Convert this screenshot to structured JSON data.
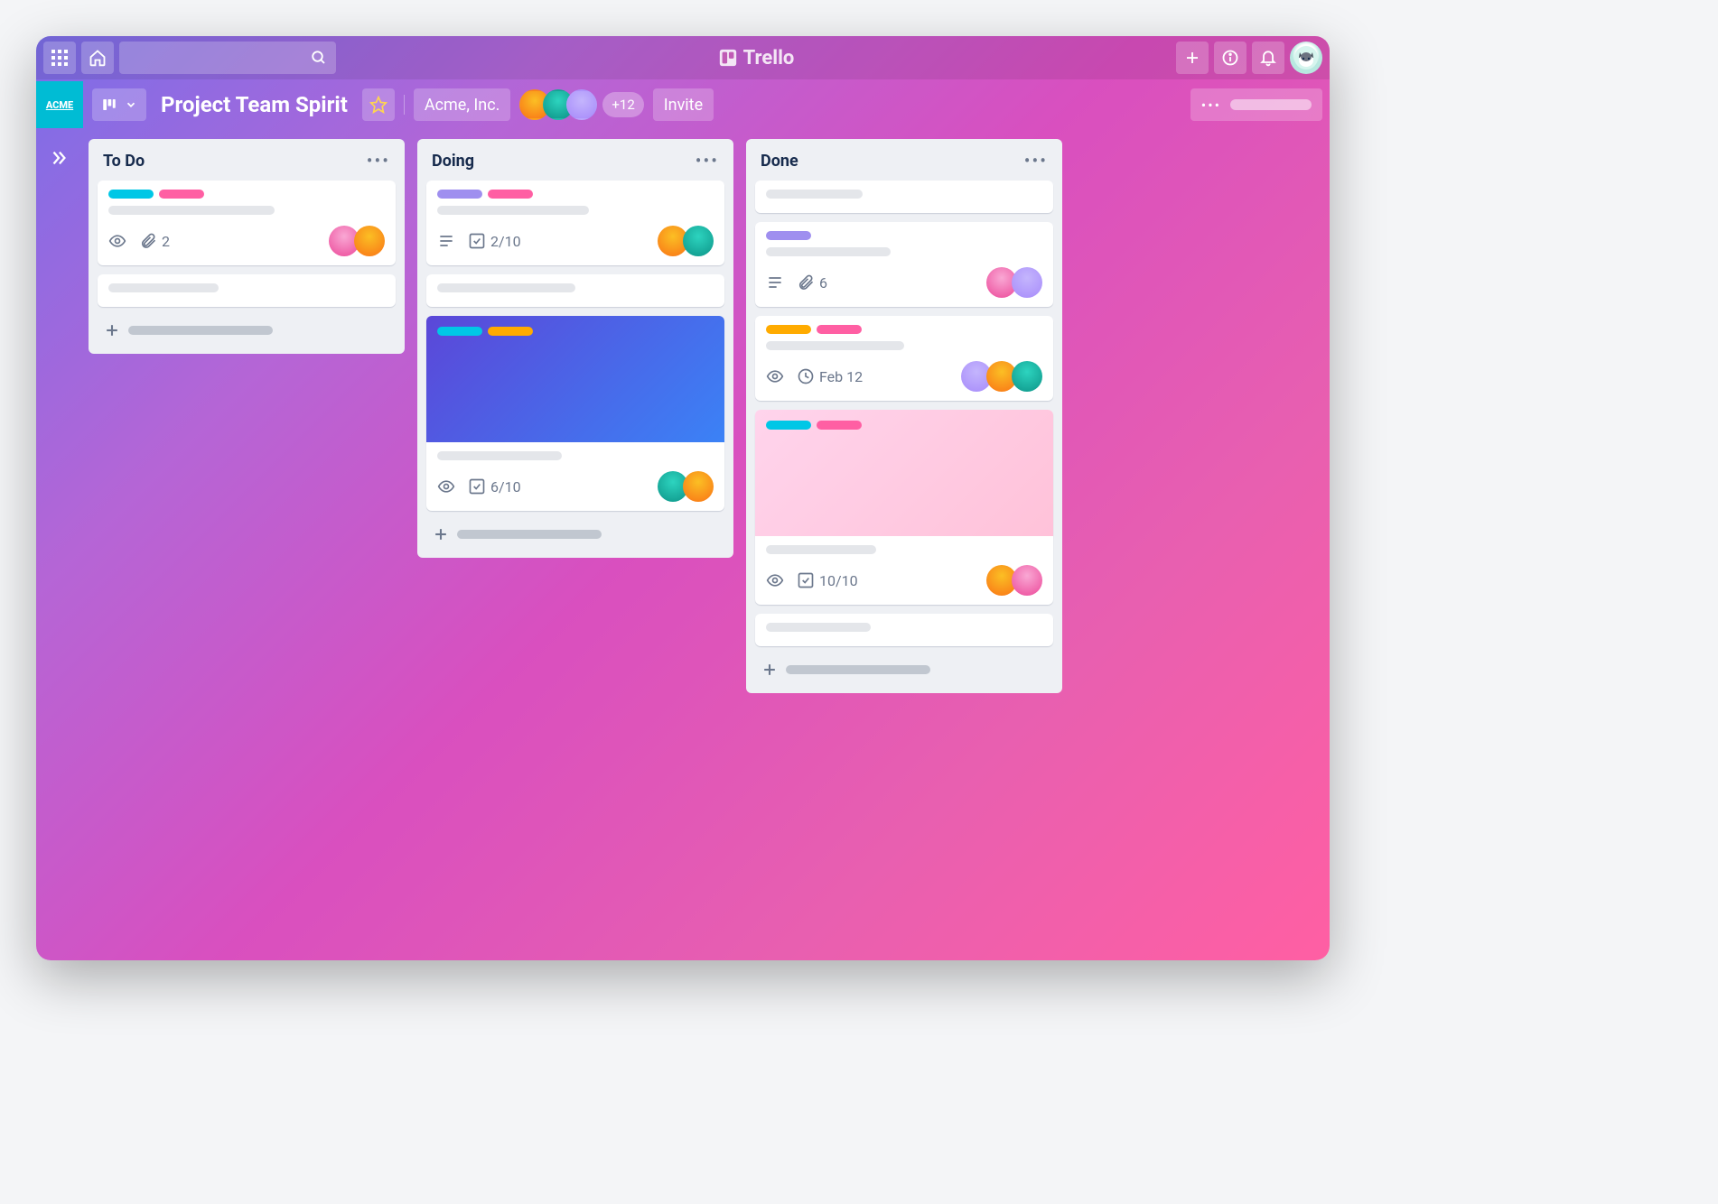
{
  "app": {
    "name": "Trello"
  },
  "topbar": {
    "icons": {
      "apps": "apps",
      "home": "home",
      "search": "search",
      "create": "create",
      "info": "info",
      "notifications": "notifications"
    }
  },
  "board": {
    "workspace_badge": "ACME",
    "title": "Project Team Spirit",
    "team": "Acme, Inc.",
    "extra_members": "+12",
    "invite_label": "Invite"
  },
  "lists": [
    {
      "title": "To Do",
      "cards": [
        {
          "labels": [
            "#00c7e6",
            "#ff5fa3"
          ],
          "badges": {
            "watch": true,
            "attachments": "2"
          },
          "members": [
            "pink",
            "orange"
          ]
        },
        {
          "placeholder": true
        }
      ]
    },
    {
      "title": "Doing",
      "cards": [
        {
          "labels": [
            "#9f8fef",
            "#ff5fa3"
          ],
          "badges": {
            "description": true,
            "checklist": "2/10"
          },
          "members": [
            "orange",
            "teal"
          ]
        },
        {
          "placeholder": true
        },
        {
          "cover": "gradient-blue",
          "cover_labels": [
            "#00c7e6",
            "#ffab00"
          ],
          "badges": {
            "watch": true,
            "checklist": "6/10"
          },
          "members": [
            "teal",
            "orange"
          ]
        }
      ]
    },
    {
      "title": "Done",
      "cards": [
        {
          "placeholder": true
        },
        {
          "labels": [
            "#9f8fef"
          ],
          "badges": {
            "description": true,
            "attachments": "6"
          },
          "members": [
            "pink",
            "purple"
          ]
        },
        {
          "labels": [
            "#ffab00",
            "#ff5fa3"
          ],
          "badges": {
            "watch": true,
            "due": "Feb 12"
          },
          "members": [
            "purple",
            "orange",
            "teal"
          ]
        },
        {
          "cover": "gradient-pink",
          "cover_labels": [
            "#00c7e6",
            "#ff5fa3"
          ],
          "badges": {
            "watch": true,
            "checklist": "10/10"
          },
          "members": [
            "orange",
            "pink"
          ]
        },
        {
          "placeholder": true
        }
      ]
    }
  ]
}
